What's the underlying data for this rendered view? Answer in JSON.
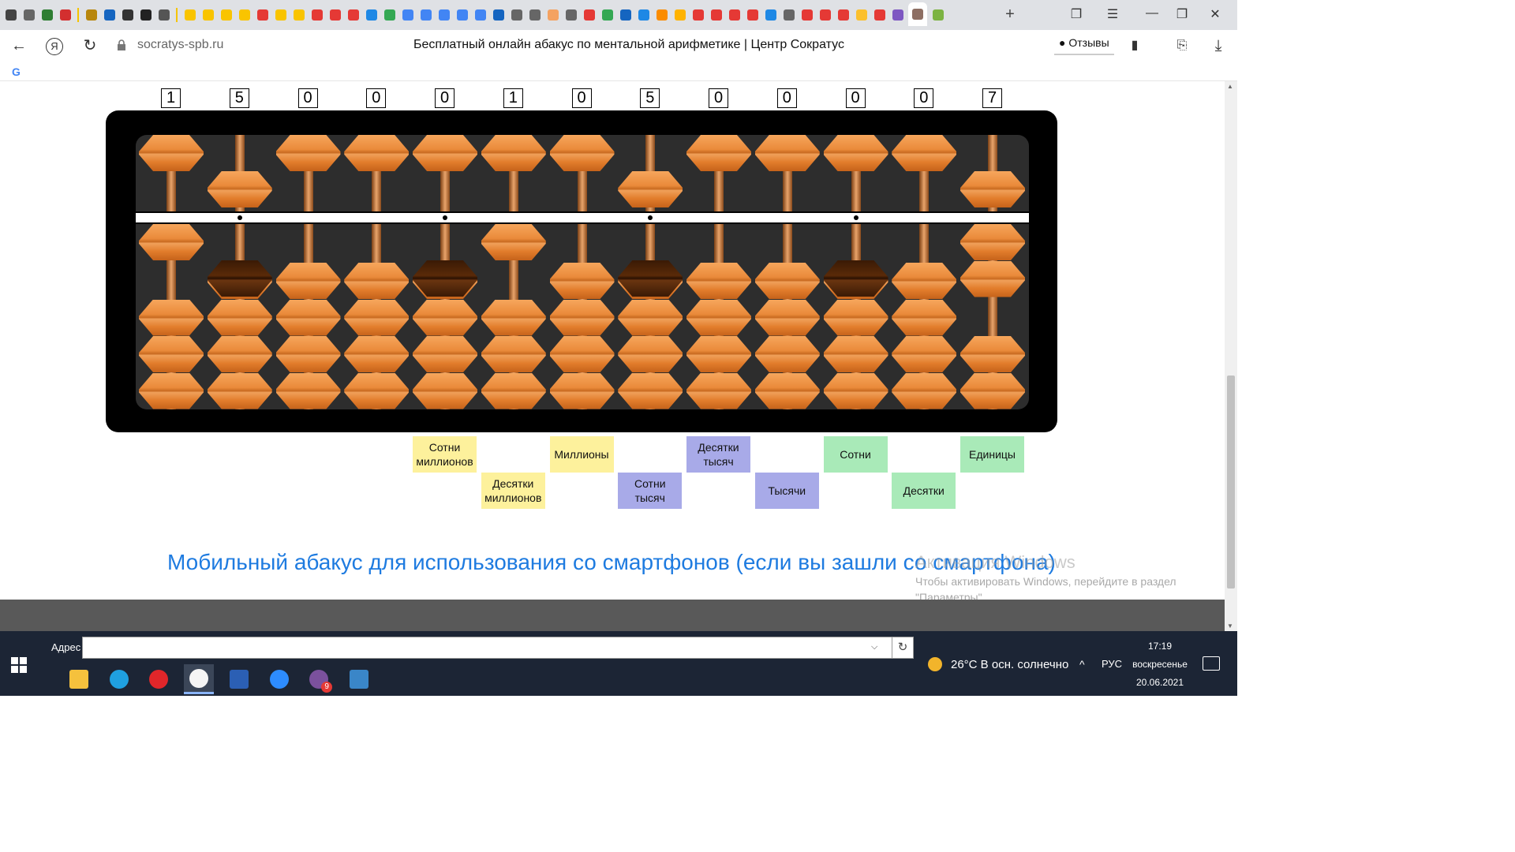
{
  "browser": {
    "domain": "socratys-spb.ru",
    "page_title": "Бесплатный онлайн абакус по ментальной арифметике | Центр Сократус",
    "reviews_label": "Отзывы",
    "new_tab": "+",
    "tab_favicon_colors": [
      "#444",
      "#666",
      "#2e7d32",
      "#d32f2f",
      "#b8860b",
      "#1565c0",
      "#333",
      "#222",
      "#555",
      "#f9c400",
      "#f9c400",
      "#f9c400",
      "#f9c400",
      "#e53935",
      "#f9c400",
      "#f9c400",
      "#e53935",
      "#e53935",
      "#e53935",
      "#1e88e5",
      "#34a853",
      "#4285f4",
      "#4285f4",
      "#4285f4",
      "#4285f4",
      "#4285f4",
      "#1565c0",
      "#666",
      "#666",
      "#f4a261",
      "#666",
      "#e53935",
      "#34a853",
      "#1565c0",
      "#1e88e5",
      "#fb8c00",
      "#ffb300",
      "#e53935",
      "#e53935",
      "#e53935",
      "#e53935",
      "#1e88e5",
      "#666",
      "#e53935",
      "#e53935",
      "#e53935",
      "#fbc02d",
      "#e53935",
      "#7e57c2",
      "#8d6e63",
      "#7cb342"
    ],
    "bookmark_icon": "G"
  },
  "abacus": {
    "digits": [
      "1",
      "5",
      "0",
      "0",
      "0",
      "1",
      "0",
      "5",
      "0",
      "0",
      "0",
      "0",
      "7"
    ],
    "dot_positions_after_rod": [
      1,
      4,
      7,
      10
    ],
    "bead_color": "#ea8a3a",
    "dark_bead_color": "#3a1a05"
  },
  "place_labels": [
    {
      "text": "Сотни миллионов",
      "color": "yellow"
    },
    {
      "text": "Десятки миллионов",
      "color": "yellow"
    },
    {
      "text": "Миллионы",
      "color": "yellow"
    },
    {
      "text": "Сотни тысяч",
      "color": "blue"
    },
    {
      "text": "Десятки тысяч",
      "color": "blue"
    },
    {
      "text": "Тысячи",
      "color": "blue"
    },
    {
      "text": "Сотни",
      "color": "green"
    },
    {
      "text": "Десятки",
      "color": "green"
    },
    {
      "text": "Единицы",
      "color": "green"
    }
  ],
  "mobile_link": "Мобильный абакус для использования со смартфонов (если вы зашли со смартфона)",
  "watermark": {
    "title": "Активация Windows",
    "text": "Чтобы активировать Windows, перейдите в раздел \"Параметры\"."
  },
  "taskbar": {
    "address_label": "Адрес",
    "address_value": "",
    "weather": "26°C  В осн. солнечно",
    "lang": "РУС",
    "time": "17:19",
    "day": "воскресенье",
    "date": "20.06.2021",
    "viber_badge": "9",
    "apps": [
      "file-explorer-icon",
      "edge-icon",
      "opera-icon",
      "yandex-browser-icon",
      "word-icon",
      "zoom-icon",
      "viber-icon",
      "snipping-tool-icon"
    ]
  }
}
